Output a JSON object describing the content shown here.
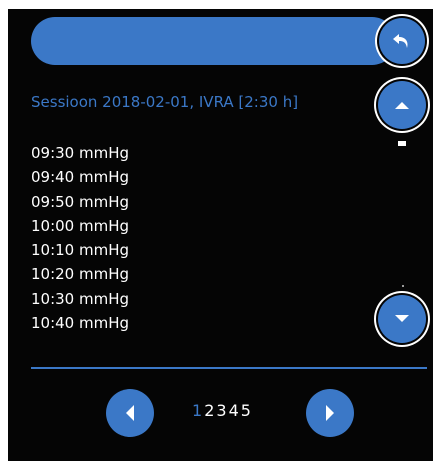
{
  "session": {
    "title": "Sessioon 2018-02-01, IVRA [2:30 h]"
  },
  "readings": [
    "09:30 mmHg",
    "09:40 mmHg",
    "09:50 mmHg",
    "10:00 mmHg",
    "10:10 mmHg",
    "10:20 mmHg",
    "10:30 mmHg",
    "10:40 mmHg"
  ],
  "pagination": {
    "pages": [
      "1",
      "2",
      "3",
      "4",
      "5"
    ],
    "current": "1"
  },
  "icons": {
    "back": "undo-arrow-icon",
    "scroll_up": "chevron-up-icon",
    "scroll_down": "chevron-down-icon",
    "prev": "triangle-left-icon",
    "next": "triangle-right-icon"
  },
  "colors": {
    "accent": "#3b78c7",
    "background": "#050505",
    "text": "#ffffff"
  }
}
